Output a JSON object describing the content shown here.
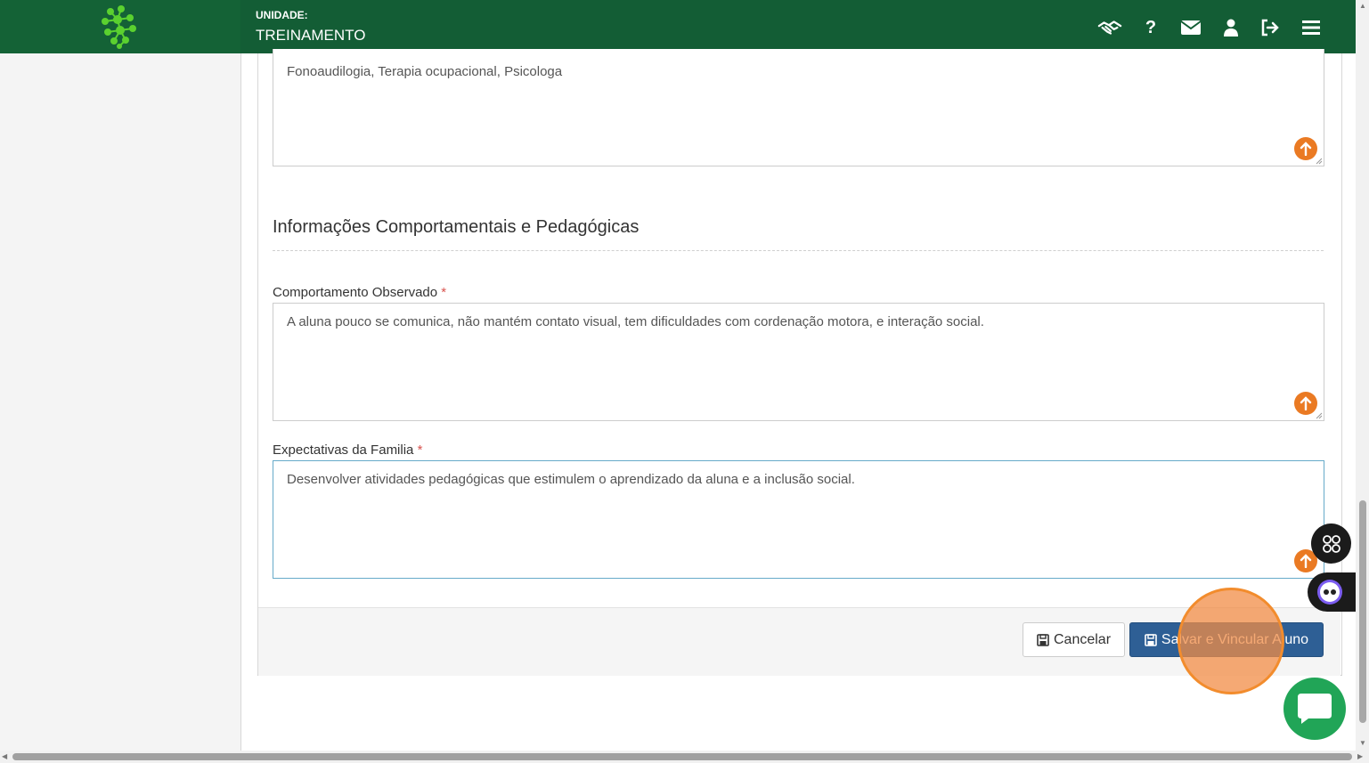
{
  "header": {
    "unit_label": "UNIDADE:",
    "unit_name": "TREINAMENTO",
    "icons": [
      "handshake-icon",
      "question-icon",
      "envelope-icon",
      "user-icon",
      "sign-out-icon",
      "menu-icon"
    ]
  },
  "fields": {
    "previous_value": "Fonoaudilogia, Terapia ocupacional, Psicologa",
    "section_title": "Informações Comportamentais e Pedagógicas",
    "behavior_label": "Comportamento Observado",
    "behavior_value": "A aluna pouco se comunica, não mantém contato visual, tem dificuldades com cordenação motora, e interação social.",
    "family_label": "Expectativas da Familia",
    "family_value": "Desenvolver atividades pedagógicas que estimulem o aprendizado da aluna e a inclusão social.",
    "required_mark": "*"
  },
  "actions": {
    "cancel_label": "Cancelar",
    "save_label": "Salvar e Vincular Aluno"
  },
  "colors": {
    "topbar": "#135d35",
    "accent_orange": "#ea7a23",
    "save_button": "#2e5f95",
    "chat": "#21a557"
  }
}
